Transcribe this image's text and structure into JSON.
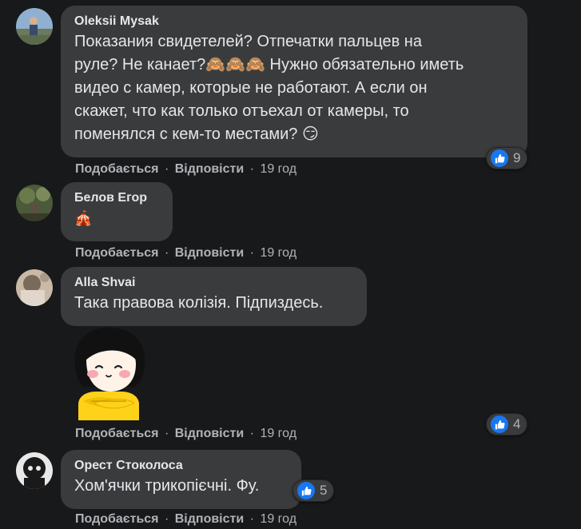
{
  "comments": [
    {
      "author": "Oleksii Mysak",
      "text": "Показания свидетелей? Отпечатки пальцев на\nруле? Не канает?🙈🙈🙈 Нужно обязательно иметь\nвидео с камер, которые не работают. А если он\nскажет, что как только отъехал от камеры, то\nпоменялся с кем-то местами? 😏",
      "like_action": "Подобається",
      "reply_action": "Відповісти",
      "time": "19 год",
      "reaction_count": "9",
      "reaction_icon": "like-icon"
    },
    {
      "author": "Белов Егор",
      "text": "🎪",
      "like_action": "Подобається",
      "reply_action": "Відповісти",
      "time": "19 год"
    },
    {
      "author": "Alla Shvai",
      "text": "Така правова колізія. Підпиздесь.",
      "sticker": "girl-hiding-sticker",
      "like_action": "Подобається",
      "reply_action": "Відповісти",
      "time": "19 год",
      "reaction_count": "4",
      "reaction_icon": "like-icon"
    },
    {
      "author": "Орест Стоколоса",
      "text": "Хом'ячки трикопієчні. Фу.",
      "like_action": "Подобається",
      "reply_action": "Відповісти",
      "time": "19 год",
      "reaction_count": "5",
      "reaction_icon": "like-icon"
    }
  ],
  "separator": "·",
  "colors": {
    "background": "#18191a",
    "bubble": "#3a3b3c",
    "text_primary": "#e4e6eb",
    "text_secondary": "#b0b3b8",
    "like_blue": "#1877f2"
  }
}
